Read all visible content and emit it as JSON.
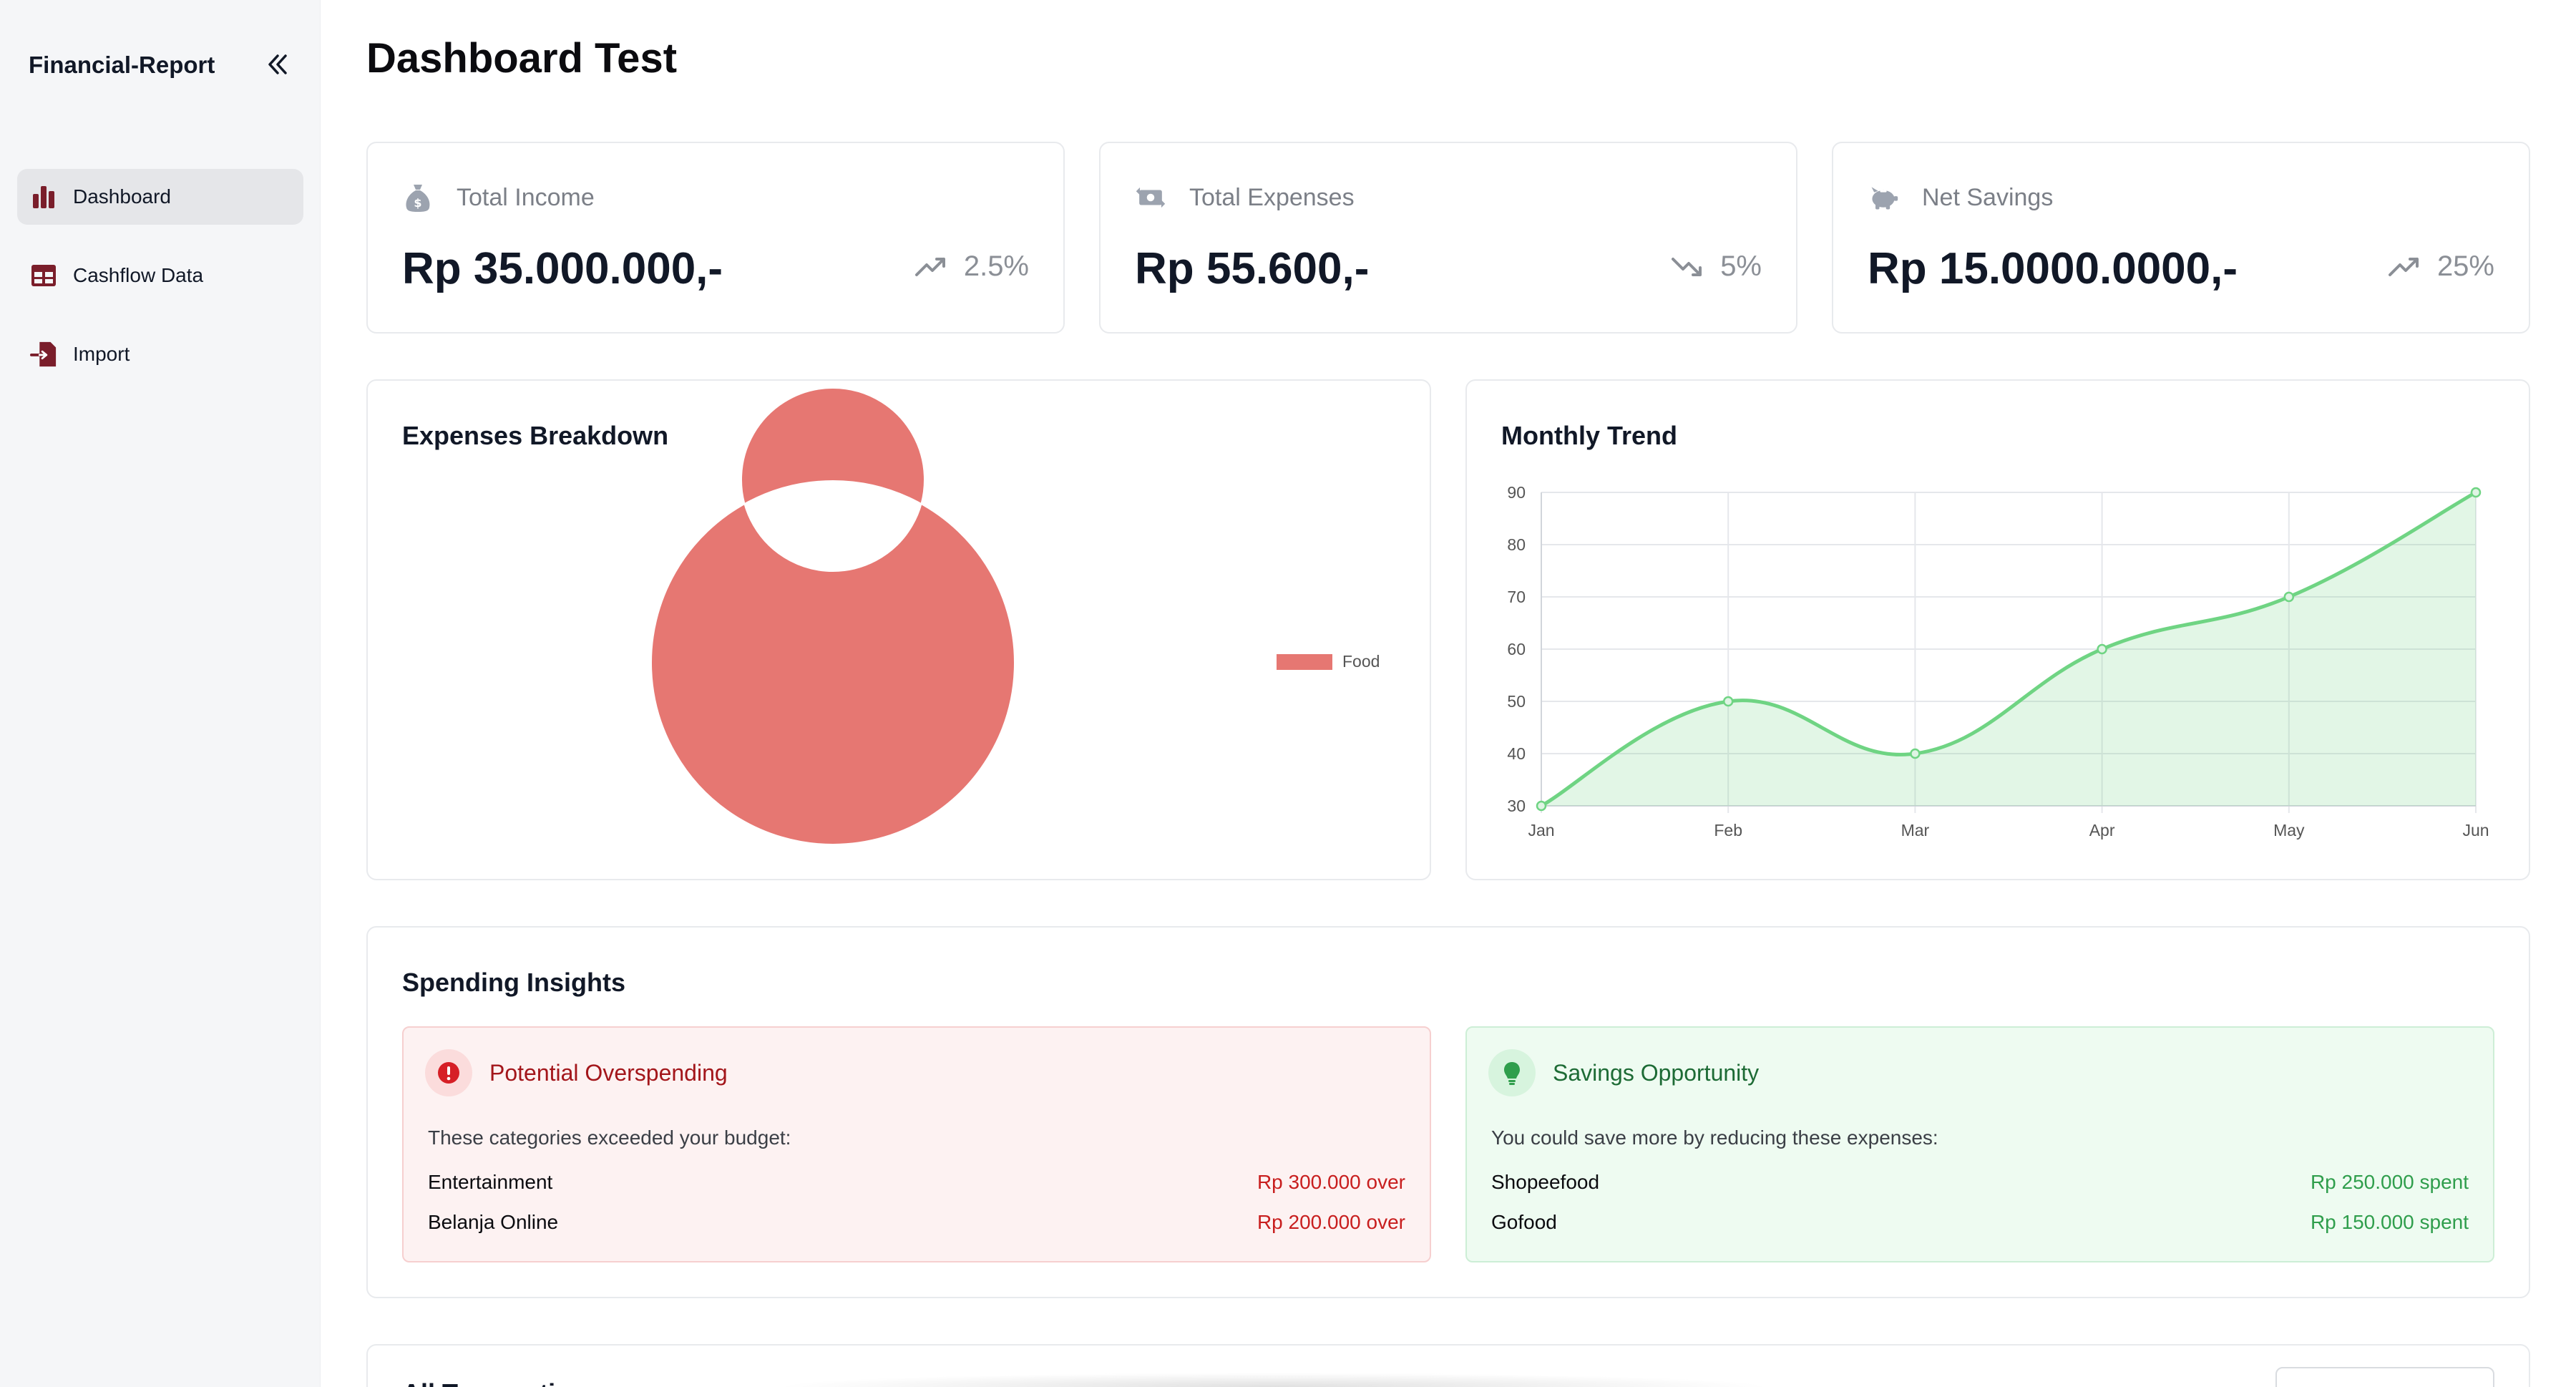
{
  "sidebar": {
    "brand": "Financial-Report",
    "items": [
      {
        "label": "Dashboard",
        "icon": "bar-chart-icon",
        "active": true
      },
      {
        "label": "Cashflow Data",
        "icon": "table-icon",
        "active": false
      },
      {
        "label": "Import",
        "icon": "file-import-icon",
        "active": false
      }
    ]
  },
  "page": {
    "title": "Dashboard Test"
  },
  "stats": [
    {
      "label": "Total Income",
      "icon": "money-bag-icon",
      "value": "Rp 35.000.000,-",
      "change": "2.5%",
      "trend": "up"
    },
    {
      "label": "Total Expenses",
      "icon": "money-transfer-icon",
      "value": "Rp 55.600,-",
      "change": "5%",
      "trend": "down"
    },
    {
      "label": "Net Savings",
      "icon": "piggy-bank-icon",
      "value": "Rp 15.0000.0000,-",
      "change": "25%",
      "trend": "up"
    }
  ],
  "expenses": {
    "title": "Expenses Breakdown"
  },
  "trend": {
    "title": "Monthly Trend"
  },
  "chart_data": [
    {
      "type": "pie",
      "categories": [
        "Food"
      ],
      "values": [
        100
      ],
      "legend": "right",
      "colors": [
        "#e67772"
      ]
    },
    {
      "type": "area",
      "x": [
        "Jan",
        "Feb",
        "Mar",
        "Apr",
        "May",
        "Jun"
      ],
      "values": [
        30,
        50,
        40,
        60,
        70,
        90
      ],
      "ylim": [
        30,
        90
      ],
      "yticks": [
        "30",
        "40",
        "50",
        "60",
        "70",
        "80",
        "90"
      ],
      "grid": true,
      "colors": [
        "#6fd483"
      ]
    }
  ],
  "insights": {
    "title": "Spending Insights",
    "overspending": {
      "title": "Potential Overspending",
      "icon": "alert-circle-icon",
      "description": "These categories exceeded your budget:",
      "rows": [
        {
          "name": "Entertainment",
          "amount": "Rp 300.000 over"
        },
        {
          "name": "Belanja Online",
          "amount": "Rp 200.000 over"
        }
      ]
    },
    "savings": {
      "title": "Savings Opportunity",
      "icon": "lightbulb-icon",
      "description": "You could save more by reducing these expenses:",
      "rows": [
        {
          "name": "Shopeefood",
          "amount": "Rp 250.000 spent"
        },
        {
          "name": "Gofood",
          "amount": "Rp 150.000 spent"
        }
      ]
    }
  },
  "transactions": {
    "title": "All Transactions"
  },
  "colors": {
    "accent": "#7a1e2b",
    "danger": "#c81e1e",
    "success": "#2f9e4c"
  }
}
